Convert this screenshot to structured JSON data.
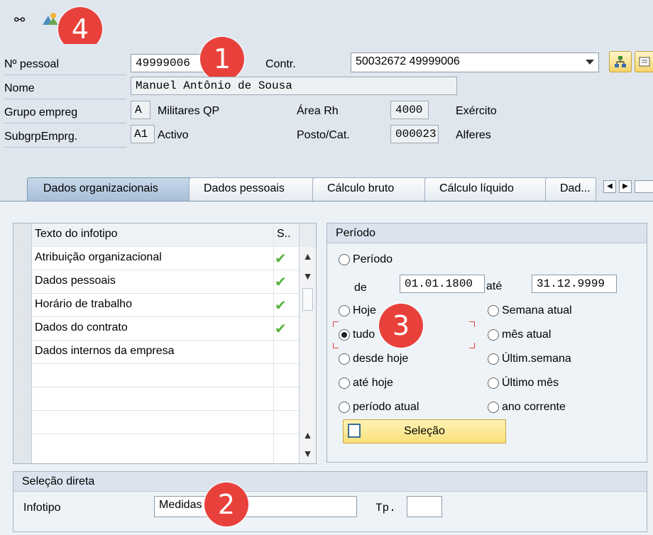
{
  "header": {
    "pernr_label": "Nº pessoal",
    "pernr_value": "49999006",
    "contract_label": "Contr.",
    "contract_value": "50032672 49999006",
    "name_label": "Nome",
    "name_value": "Manuel Antônio de Sousa",
    "empgroup_label": "Grupo empreg",
    "empgroup_code": "A",
    "empgroup_text": "Militares QP",
    "hrarea_label": "Área Rh",
    "hrarea_code": "4000",
    "hrarea_text": "Exército",
    "subgroup_label": "SubgrpEmprg.",
    "subgroup_code": "A1",
    "subgroup_text": "Activo",
    "post_label": "Posto/Cat.",
    "post_code": "000023",
    "post_text": "Alferes"
  },
  "tabs": [
    {
      "label": "Dados organizacionais"
    },
    {
      "label": "Dados pessoais"
    },
    {
      "label": "Cálculo bruto"
    },
    {
      "label": "Cálculo líquido"
    },
    {
      "label": "Dad..."
    }
  ],
  "table": {
    "col_text": "Texto do infotipo",
    "col_status": "S..",
    "rows": [
      {
        "text": "Atribuição organizacional",
        "status": "✔"
      },
      {
        "text": "Dados pessoais",
        "status": "✔"
      },
      {
        "text": "Horário de trabalho",
        "status": "✔"
      },
      {
        "text": "Dados do contrato",
        "status": "✔"
      },
      {
        "text": "Dados internos da empresa",
        "status": ""
      }
    ]
  },
  "period": {
    "title": "Período",
    "opt_period": "Período",
    "from_label": "de",
    "from_value": "01.01.1800",
    "to_label": "até",
    "to_value": "31.12.9999",
    "opt_today": "Hoje",
    "opt_all": "tudo",
    "opt_from_today": "desde hoje",
    "opt_to_today": "até hoje",
    "opt_current": "período atual",
    "opt_week": "Semana atual",
    "opt_month": "mês atual",
    "opt_last_week": "Últim.semana",
    "opt_last_month": "Último mês",
    "opt_year": "ano corrente",
    "select_button": "Seleção"
  },
  "direct": {
    "title": "Seleção direta",
    "infotype_label": "Infotipo",
    "infotype_value": "Medidas",
    "type_label": "Tp.",
    "type_value": ""
  },
  "badges": {
    "b1": "1",
    "b2": "2",
    "b3": "3",
    "b4": "4"
  },
  "colors": {
    "badge": "#e8413b",
    "check": "#58b340",
    "button_yellow": "#fae07a"
  }
}
